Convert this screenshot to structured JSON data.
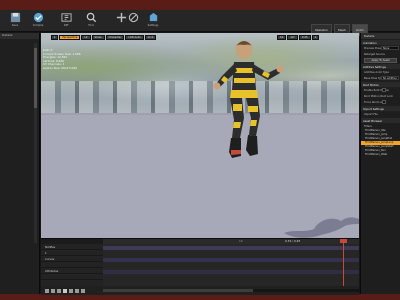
{
  "toolbar": {
    "buttons": [
      {
        "icon": "save-icon",
        "label": "Save"
      },
      {
        "icon": "compile-icon",
        "label": "Compile"
      },
      {
        "icon": "diff-icon",
        "label": "Diff"
      },
      {
        "icon": "search-icon",
        "label": "Find"
      },
      {
        "icon": "settings-icon",
        "label": "Settings"
      }
    ]
  },
  "mode_tabs": {
    "t1": "Skeleton",
    "t2": "Mesh",
    "t3": "Anim"
  },
  "left_panel": {
    "title": "Details"
  },
  "viewport": {
    "buttons": [
      "Perspective",
      "Lit",
      "Show",
      "Character",
      "LOD Auto",
      "x1.0"
    ],
    "right_buttons": [
      "10",
      "10°",
      "0.25",
      "4"
    ],
    "stats": [
      "LOD: 0",
      "Current Screen Size: 1.096",
      "Triangles: 12,562",
      "Vertices: 8,946",
      "UV Channels: 1",
      "Approx Size: 68x47x180"
    ]
  },
  "right_panel": {
    "title": "Details",
    "sections": {
      "animation": "Animation",
      "additive": "Additive Settings",
      "root_motion": "Root Motion",
      "import": "Import Settings",
      "asset_browser": "Asset Browser"
    },
    "rows": {
      "preview_pose": "Preview Pose",
      "preview_val": "None",
      "retarget": "Retarget Source",
      "apply": "Apply To Asset",
      "additive_type": "Additive Anim Type",
      "additive_val": "No additive",
      "base_pose": "Base Pose Type",
      "enable_root": "Enable Root Motion",
      "root_lock": "Root Motion Root Lock",
      "force_root": "Force Root Lock",
      "compression": "Compression",
      "import_file": "Import File"
    },
    "filters": "Filters",
    "assets": [
      "ThirdPerson_Idle",
      "ThirdPerson_Jump",
      "ThirdPerson_JumpEnd",
      "ThirdPerson_JumpLoop",
      "ThirdPerson_JumpStart",
      "ThirdPerson_Run",
      "ThirdPerson_Walk"
    ],
    "selected_asset": 3
  },
  "timeline": {
    "tracks": [
      "Notifies",
      "1",
      "Curves",
      "",
      "Attributes",
      ""
    ],
    "time_readout": "0.32 / 0.93",
    "frame_label": "10"
  },
  "colors": {
    "accent": "#f2a32b",
    "playhead": "#c64a3a",
    "outer_frame": "#5a1c17"
  }
}
